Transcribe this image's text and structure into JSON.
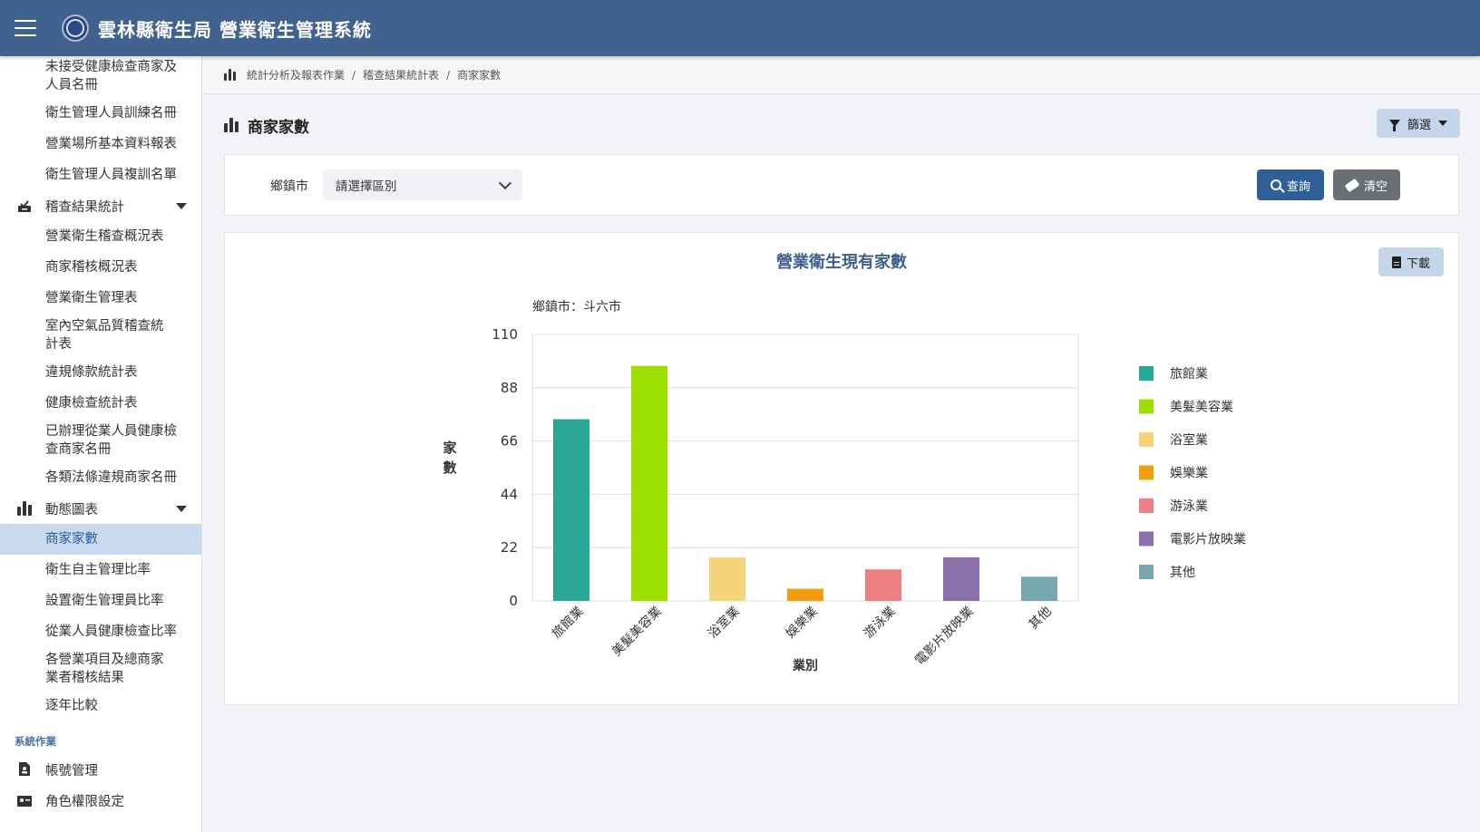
{
  "header": {
    "title": "雲林縣衛生局 營業衛生管理系統"
  },
  "sidebar": {
    "items": [
      {
        "label": "未接受健康檢查商家及人員名冊"
      },
      {
        "label": "衛生管理人員訓練名冊"
      },
      {
        "label": "營業場所基本資料報表"
      },
      {
        "label": "衛生管理人員複訓名單"
      }
    ],
    "group_inspection": {
      "label": "稽查結果統計"
    },
    "inspection_items": [
      {
        "label": "營業衛生稽查概況表"
      },
      {
        "label": "商家稽核概況表"
      },
      {
        "label": "營業衛生管理表"
      },
      {
        "label": "室內空氣品質稽查統計表"
      },
      {
        "label": "違規條款統計表"
      },
      {
        "label": "健康檢查統計表"
      },
      {
        "label": "已辦理從業人員健康檢查商家名冊"
      },
      {
        "label": "各類法條違規商家名冊"
      }
    ],
    "group_charts": {
      "label": "動態圖表"
    },
    "chart_items": [
      {
        "label": "商家家數"
      },
      {
        "label": "衛生自主管理比率"
      },
      {
        "label": "設置衛生管理員比率"
      },
      {
        "label": "從業人員健康檢查比率"
      },
      {
        "label": "各營業項目及總商家業者稽核結果"
      },
      {
        "label": "逐年比較"
      }
    ],
    "section_system": "系統作業",
    "system_items": [
      {
        "label": "帳號管理"
      },
      {
        "label": "角色權限設定"
      }
    ]
  },
  "breadcrumb": {
    "level1": "統計分析及報表作業",
    "level2": "稽查結果統計表",
    "level3": "商家家數"
  },
  "page": {
    "title": "商家家數",
    "filter_label": "篩選"
  },
  "query": {
    "town_label": "鄉鎮市",
    "town_placeholder": "請選擇區別",
    "search_label": "查詢",
    "clear_label": "清空"
  },
  "chart_panel": {
    "download_label": "下載"
  },
  "chart_data": {
    "type": "bar",
    "title": "營業衛生現有家數",
    "subtitle": "鄉鎮市：斗六市",
    "xlabel": "業別",
    "ylabel": "家數",
    "ylim": [
      0,
      110
    ],
    "yticks": [
      0,
      22,
      44,
      66,
      88,
      110
    ],
    "grid": true,
    "legend_position": "right",
    "categories": [
      "旅館業",
      "美髮美容業",
      "浴室業",
      "娛樂業",
      "游泳業",
      "電影片放映業",
      "其他"
    ],
    "values": [
      75,
      97,
      18,
      5,
      13,
      18,
      10
    ],
    "colors": [
      "#2ba796",
      "#9de000",
      "#f4d57a",
      "#f39c12",
      "#ec7f7f",
      "#8a71a9",
      "#76a8ae"
    ]
  }
}
